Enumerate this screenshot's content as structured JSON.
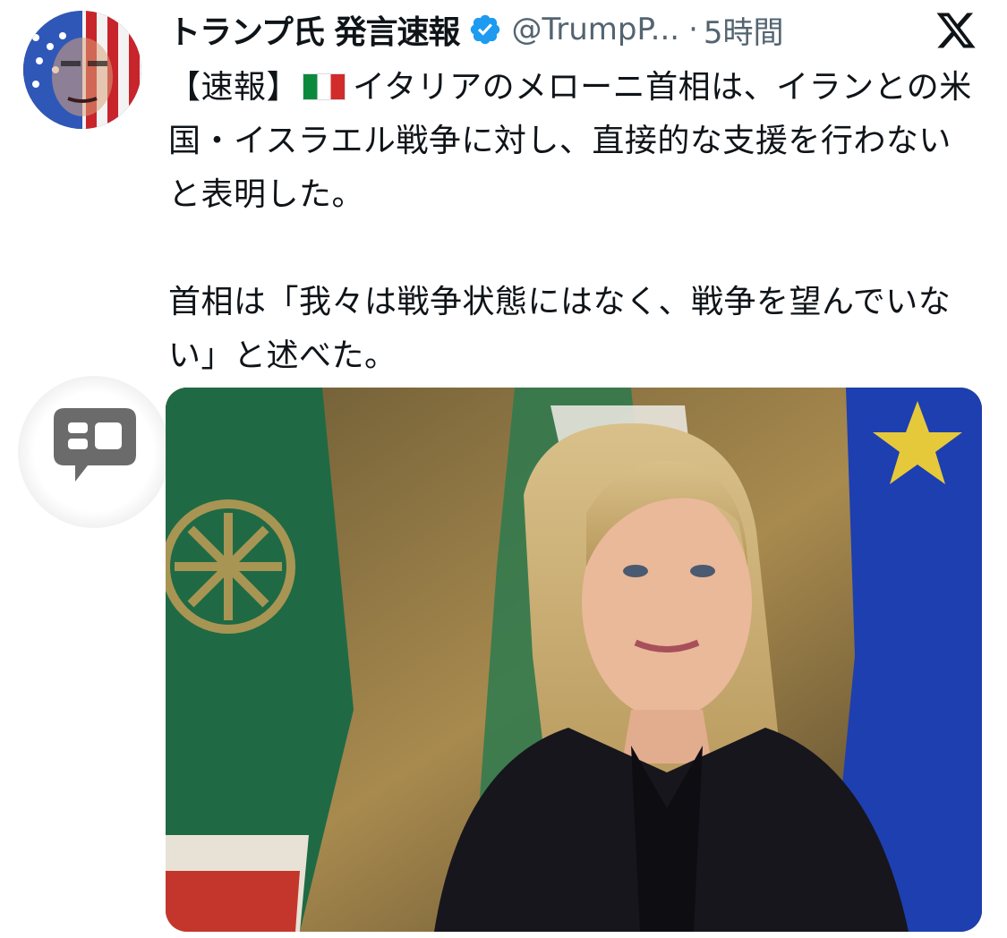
{
  "post": {
    "display_name": "トランプ氏 発言速報",
    "handle": "@TrumpP...",
    "separator": "·",
    "time": "5時間",
    "text_prefix": "【速報】",
    "text_line1": "イタリアのメローニ首相は、イランとの米国・イスラエル戦争に対し、直接的な支援を行わないと表明した。",
    "text_line2": "首相は「我々は戦争状態にはなく、戦争を望んでいない」と述べた。",
    "flag_icon": "italy-flag",
    "verified_icon": "verified-badge-icon",
    "platform_icon": "x-logo-icon"
  },
  "colors": {
    "text": "#0f1419",
    "secondary": "#536471",
    "verified": "#1d9bf0",
    "quote_icon": "#6b6b6b"
  }
}
